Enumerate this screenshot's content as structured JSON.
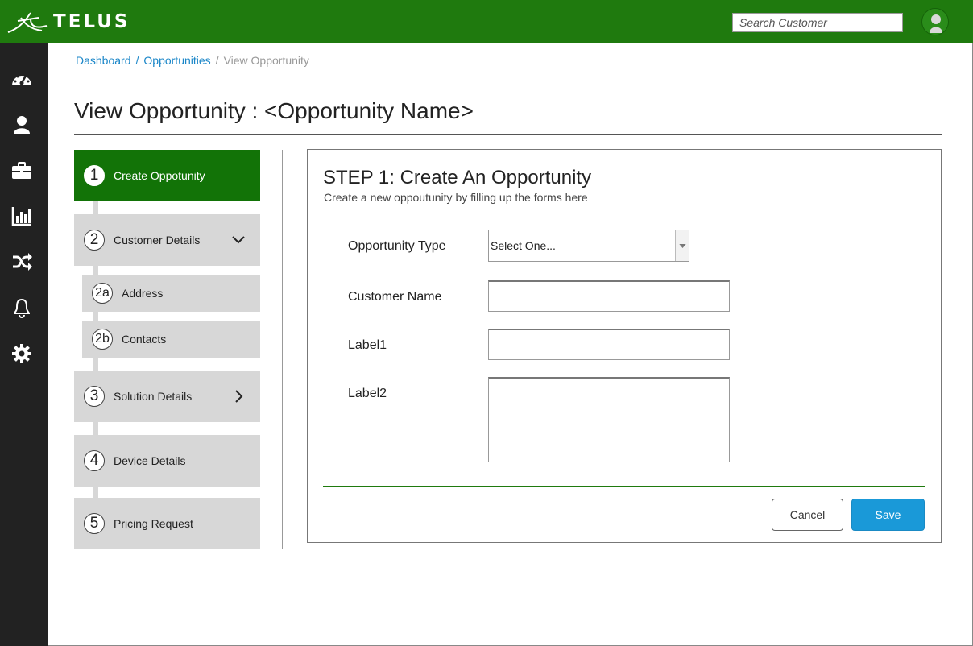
{
  "brand": {
    "name": "TELUS",
    "color": "#1f7a0e"
  },
  "search": {
    "placeholder": "Search Customer"
  },
  "user": {
    "avatar_icon": "user-avatar-icon"
  },
  "nav": {
    "items": [
      {
        "name": "dashboard",
        "icon": "speedometer-icon"
      },
      {
        "name": "customers",
        "icon": "user-icon"
      },
      {
        "name": "opportunities",
        "icon": "briefcase-icon"
      },
      {
        "name": "reports",
        "icon": "bar-chart-icon"
      },
      {
        "name": "workflow",
        "icon": "shuffle-icon"
      },
      {
        "name": "notifications",
        "icon": "bell-icon"
      },
      {
        "name": "settings",
        "icon": "gear-icon"
      }
    ]
  },
  "breadcrumb": {
    "items": [
      "Dashboard",
      "Opportunities"
    ],
    "current": "View Opportunity",
    "separator": "/"
  },
  "page": {
    "title": "View Opportunity : <Opportunity Name>"
  },
  "steps": [
    {
      "num": "1",
      "label": "Create Oppotunity",
      "active": true
    },
    {
      "num": "2",
      "label": "Customer Details",
      "expanded": true
    },
    {
      "num": "2a",
      "label": "Address"
    },
    {
      "num": "2b",
      "label": "Contacts"
    },
    {
      "num": "3",
      "label": "Solution Details"
    },
    {
      "num": "4",
      "label": "Device Details"
    },
    {
      "num": "5",
      "label": "Pricing Request"
    }
  ],
  "form": {
    "title": "STEP 1: Create An Opportunity",
    "subtitle": "Create a new oppoutunity by filling up the forms here",
    "fields": {
      "opportunity_type": {
        "label": "Opportunity Type",
        "value": "Select One..."
      },
      "customer_name": {
        "label": "Customer Name",
        "value": ""
      },
      "label1": {
        "label": "Label1",
        "value": ""
      },
      "label2": {
        "label": "Label2",
        "value": ""
      }
    },
    "cancel_label": "Cancel",
    "save_label": "Save",
    "save_color": "#1a99d8"
  }
}
